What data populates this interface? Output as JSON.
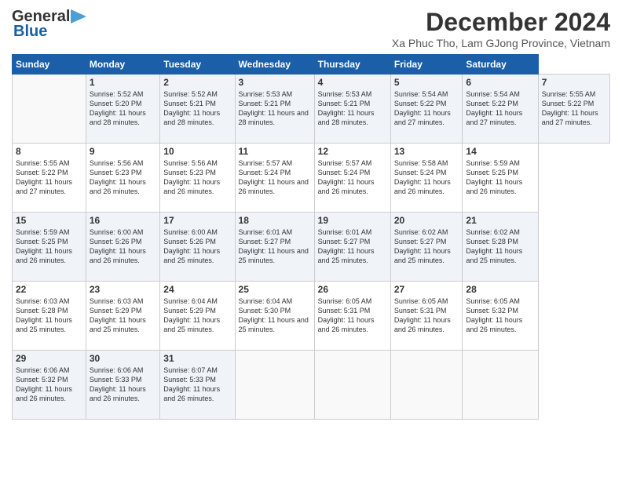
{
  "header": {
    "logo_line1": "General",
    "logo_line2": "Blue",
    "title": "December 2024",
    "subtitle": "Xa Phuc Tho, Lam GJong Province, Vietnam"
  },
  "calendar": {
    "days_of_week": [
      "Sunday",
      "Monday",
      "Tuesday",
      "Wednesday",
      "Thursday",
      "Friday",
      "Saturday"
    ],
    "weeks": [
      [
        null,
        {
          "day": "1",
          "rise": "Sunrise: 5:52 AM",
          "set": "Sunset: 5:20 PM",
          "daylight": "Daylight: 11 hours and 28 minutes."
        },
        {
          "day": "2",
          "rise": "Sunrise: 5:52 AM",
          "set": "Sunset: 5:21 PM",
          "daylight": "Daylight: 11 hours and 28 minutes."
        },
        {
          "day": "3",
          "rise": "Sunrise: 5:53 AM",
          "set": "Sunset: 5:21 PM",
          "daylight": "Daylight: 11 hours and 28 minutes."
        },
        {
          "day": "4",
          "rise": "Sunrise: 5:53 AM",
          "set": "Sunset: 5:21 PM",
          "daylight": "Daylight: 11 hours and 28 minutes."
        },
        {
          "day": "5",
          "rise": "Sunrise: 5:54 AM",
          "set": "Sunset: 5:22 PM",
          "daylight": "Daylight: 11 hours and 27 minutes."
        },
        {
          "day": "6",
          "rise": "Sunrise: 5:54 AM",
          "set": "Sunset: 5:22 PM",
          "daylight": "Daylight: 11 hours and 27 minutes."
        },
        {
          "day": "7",
          "rise": "Sunrise: 5:55 AM",
          "set": "Sunset: 5:22 PM",
          "daylight": "Daylight: 11 hours and 27 minutes."
        }
      ],
      [
        {
          "day": "8",
          "rise": "Sunrise: 5:55 AM",
          "set": "Sunset: 5:22 PM",
          "daylight": "Daylight: 11 hours and 27 minutes."
        },
        {
          "day": "9",
          "rise": "Sunrise: 5:56 AM",
          "set": "Sunset: 5:23 PM",
          "daylight": "Daylight: 11 hours and 26 minutes."
        },
        {
          "day": "10",
          "rise": "Sunrise: 5:56 AM",
          "set": "Sunset: 5:23 PM",
          "daylight": "Daylight: 11 hours and 26 minutes."
        },
        {
          "day": "11",
          "rise": "Sunrise: 5:57 AM",
          "set": "Sunset: 5:24 PM",
          "daylight": "Daylight: 11 hours and 26 minutes."
        },
        {
          "day": "12",
          "rise": "Sunrise: 5:57 AM",
          "set": "Sunset: 5:24 PM",
          "daylight": "Daylight: 11 hours and 26 minutes."
        },
        {
          "day": "13",
          "rise": "Sunrise: 5:58 AM",
          "set": "Sunset: 5:24 PM",
          "daylight": "Daylight: 11 hours and 26 minutes."
        },
        {
          "day": "14",
          "rise": "Sunrise: 5:59 AM",
          "set": "Sunset: 5:25 PM",
          "daylight": "Daylight: 11 hours and 26 minutes."
        }
      ],
      [
        {
          "day": "15",
          "rise": "Sunrise: 5:59 AM",
          "set": "Sunset: 5:25 PM",
          "daylight": "Daylight: 11 hours and 26 minutes."
        },
        {
          "day": "16",
          "rise": "Sunrise: 6:00 AM",
          "set": "Sunset: 5:26 PM",
          "daylight": "Daylight: 11 hours and 26 minutes."
        },
        {
          "day": "17",
          "rise": "Sunrise: 6:00 AM",
          "set": "Sunset: 5:26 PM",
          "daylight": "Daylight: 11 hours and 25 minutes."
        },
        {
          "day": "18",
          "rise": "Sunrise: 6:01 AM",
          "set": "Sunset: 5:27 PM",
          "daylight": "Daylight: 11 hours and 25 minutes."
        },
        {
          "day": "19",
          "rise": "Sunrise: 6:01 AM",
          "set": "Sunset: 5:27 PM",
          "daylight": "Daylight: 11 hours and 25 minutes."
        },
        {
          "day": "20",
          "rise": "Sunrise: 6:02 AM",
          "set": "Sunset: 5:27 PM",
          "daylight": "Daylight: 11 hours and 25 minutes."
        },
        {
          "day": "21",
          "rise": "Sunrise: 6:02 AM",
          "set": "Sunset: 5:28 PM",
          "daylight": "Daylight: 11 hours and 25 minutes."
        }
      ],
      [
        {
          "day": "22",
          "rise": "Sunrise: 6:03 AM",
          "set": "Sunset: 5:28 PM",
          "daylight": "Daylight: 11 hours and 25 minutes."
        },
        {
          "day": "23",
          "rise": "Sunrise: 6:03 AM",
          "set": "Sunset: 5:29 PM",
          "daylight": "Daylight: 11 hours and 25 minutes."
        },
        {
          "day": "24",
          "rise": "Sunrise: 6:04 AM",
          "set": "Sunset: 5:29 PM",
          "daylight": "Daylight: 11 hours and 25 minutes."
        },
        {
          "day": "25",
          "rise": "Sunrise: 6:04 AM",
          "set": "Sunset: 5:30 PM",
          "daylight": "Daylight: 11 hours and 25 minutes."
        },
        {
          "day": "26",
          "rise": "Sunrise: 6:05 AM",
          "set": "Sunset: 5:31 PM",
          "daylight": "Daylight: 11 hours and 26 minutes."
        },
        {
          "day": "27",
          "rise": "Sunrise: 6:05 AM",
          "set": "Sunset: 5:31 PM",
          "daylight": "Daylight: 11 hours and 26 minutes."
        },
        {
          "day": "28",
          "rise": "Sunrise: 6:05 AM",
          "set": "Sunset: 5:32 PM",
          "daylight": "Daylight: 11 hours and 26 minutes."
        }
      ],
      [
        {
          "day": "29",
          "rise": "Sunrise: 6:06 AM",
          "set": "Sunset: 5:32 PM",
          "daylight": "Daylight: 11 hours and 26 minutes."
        },
        {
          "day": "30",
          "rise": "Sunrise: 6:06 AM",
          "set": "Sunset: 5:33 PM",
          "daylight": "Daylight: 11 hours and 26 minutes."
        },
        {
          "day": "31",
          "rise": "Sunrise: 6:07 AM",
          "set": "Sunset: 5:33 PM",
          "daylight": "Daylight: 11 hours and 26 minutes."
        },
        null,
        null,
        null,
        null
      ]
    ]
  }
}
